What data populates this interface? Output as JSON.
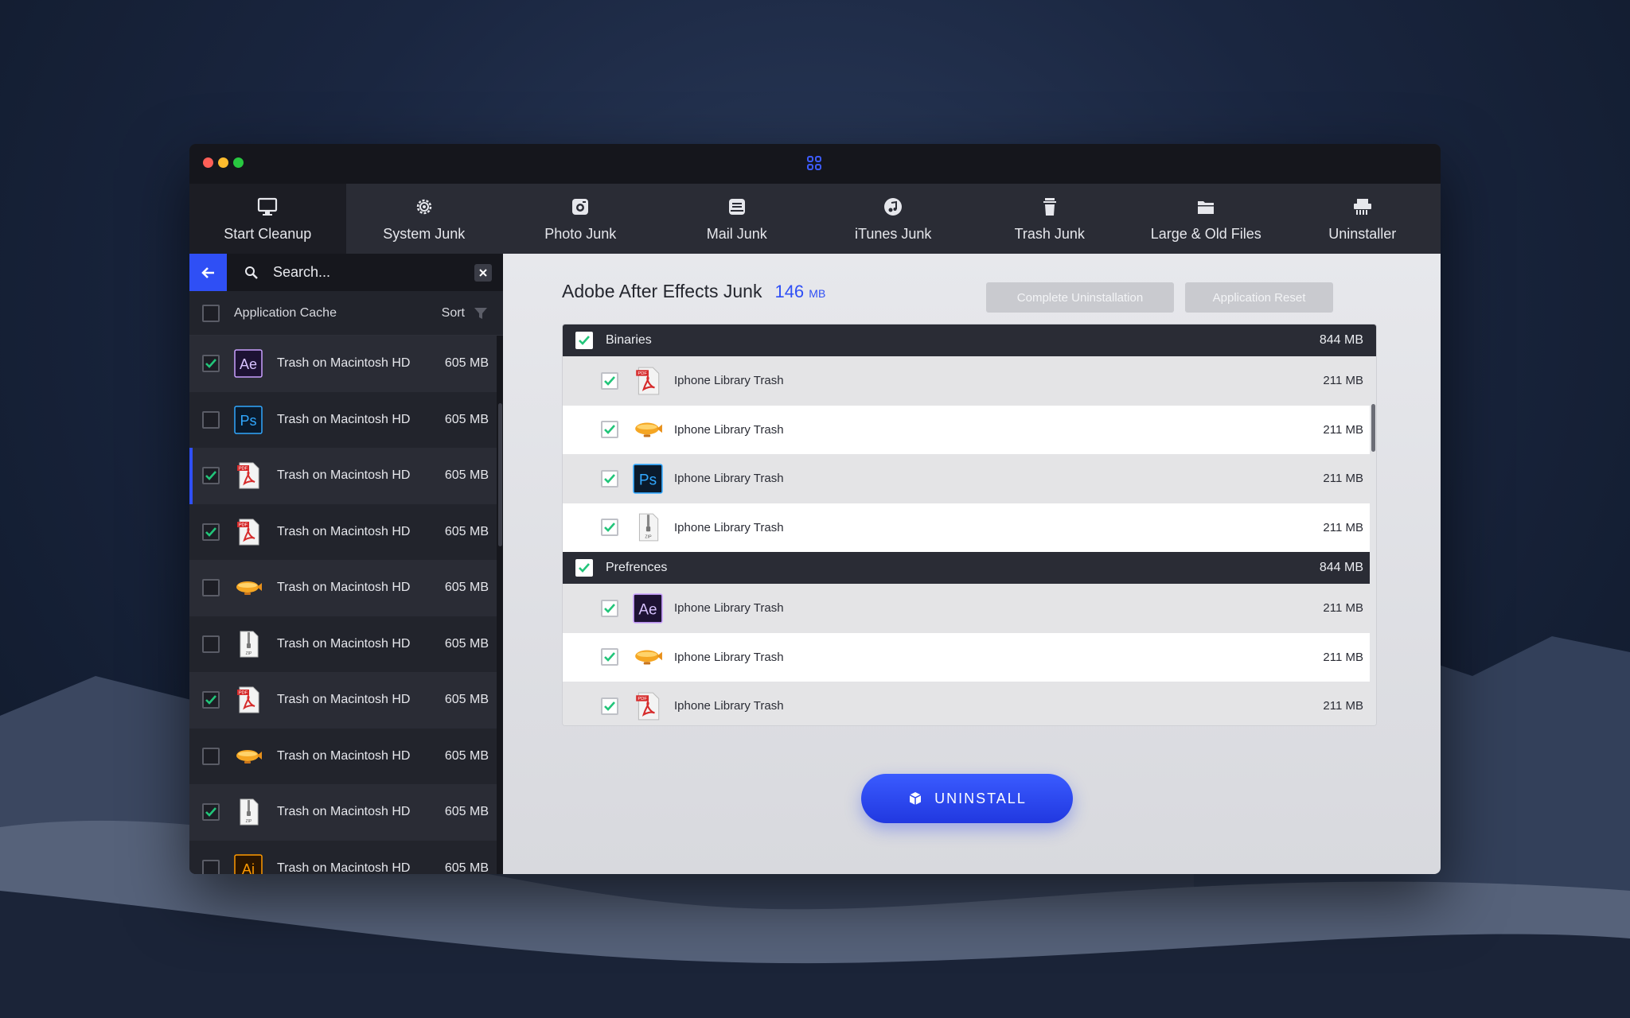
{
  "window": {
    "traffic_lights": [
      "#fe5f57",
      "#febc2e",
      "#28c840"
    ],
    "logo_icon": "app-logo-icon"
  },
  "nav": [
    {
      "label": "Start Cleanup",
      "icon": "monitor-icon",
      "active": true
    },
    {
      "label": "System Junk",
      "icon": "gear-icon"
    },
    {
      "label": "Photo Junk",
      "icon": "camera-icon"
    },
    {
      "label": "Mail Junk",
      "icon": "mail-icon"
    },
    {
      "label": "iTunes Junk",
      "icon": "music-icon"
    },
    {
      "label": "Trash Junk",
      "icon": "trash-icon"
    },
    {
      "label": "Large & Old Files",
      "icon": "folder-icon"
    },
    {
      "label": "Uninstaller",
      "icon": "shredder-icon"
    }
  ],
  "sidebar": {
    "search": {
      "placeholder": "Search..."
    },
    "filter": {
      "label": "Application Cache",
      "sort_label": "Sort"
    },
    "items": [
      {
        "name": "Trash on Macintosh HD",
        "size": "605 MB",
        "icon": "ae",
        "checked": true
      },
      {
        "name": "Trash on Macintosh HD",
        "size": "605 MB",
        "icon": "ps",
        "checked": false
      },
      {
        "name": "Trash on Macintosh HD",
        "size": "605 MB",
        "icon": "pdf",
        "checked": true,
        "selected": true
      },
      {
        "name": "Trash on Macintosh HD",
        "size": "605 MB",
        "icon": "pdf",
        "checked": true
      },
      {
        "name": "Trash on Macintosh HD",
        "size": "605 MB",
        "icon": "blimp",
        "checked": false
      },
      {
        "name": "Trash on Macintosh HD",
        "size": "605 MB",
        "icon": "zip",
        "checked": false
      },
      {
        "name": "Trash on Macintosh HD",
        "size": "605 MB",
        "icon": "pdf",
        "checked": true
      },
      {
        "name": "Trash on Macintosh HD",
        "size": "605 MB",
        "icon": "blimp",
        "checked": false
      },
      {
        "name": "Trash on Macintosh HD",
        "size": "605 MB",
        "icon": "zip",
        "checked": true
      },
      {
        "name": "Trash on Macintosh HD",
        "size": "605 MB",
        "icon": "ai",
        "checked": false
      }
    ]
  },
  "main": {
    "title": "Adobe After Effects Junk",
    "size_value": "146",
    "size_unit": "MB",
    "buttons": {
      "complete": "Complete Uninstallation",
      "reset": "Application Reset"
    },
    "groups": [
      {
        "name": "Binaries",
        "size": "844 MB",
        "checked": true,
        "rows": [
          {
            "name": "Iphone Library Trash",
            "size": "211 MB",
            "icon": "pdf",
            "checked": true
          },
          {
            "name": "Iphone Library Trash",
            "size": "211 MB",
            "icon": "blimp",
            "checked": true
          },
          {
            "name": "Iphone Library Trash",
            "size": "211 MB",
            "icon": "ps",
            "checked": true
          },
          {
            "name": "Iphone Library Trash",
            "size": "211 MB",
            "icon": "zip",
            "checked": true
          }
        ]
      },
      {
        "name": "Prefrences",
        "size": "844 MB",
        "checked": true,
        "rows": [
          {
            "name": "Iphone Library Trash",
            "size": "211 MB",
            "icon": "ae",
            "checked": true
          },
          {
            "name": "Iphone Library Trash",
            "size": "211 MB",
            "icon": "blimp",
            "checked": true
          },
          {
            "name": "Iphone Library Trash",
            "size": "211 MB",
            "icon": "pdf",
            "checked": true
          }
        ]
      }
    ],
    "uninstall_label": "UNINSTALL",
    "accent": "#2f4ff5",
    "check_color": "#22c57a"
  }
}
